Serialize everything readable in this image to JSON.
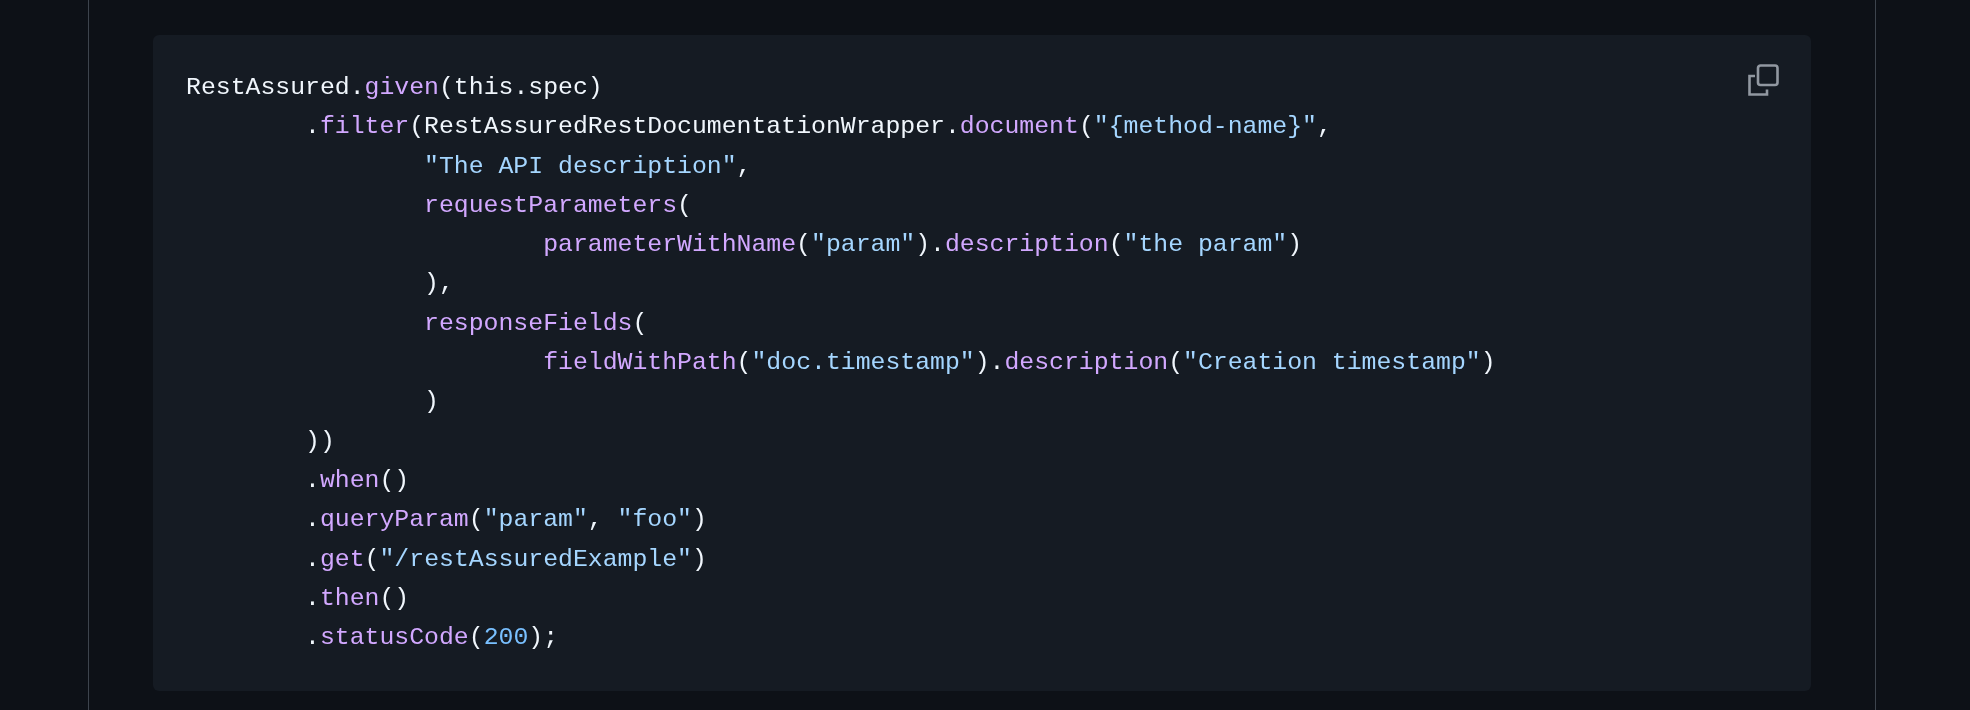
{
  "code_block": {
    "lines": [
      [
        {
          "kind": "plain",
          "text": "RestAssured."
        },
        {
          "kind": "function",
          "text": "given"
        },
        {
          "kind": "plain",
          "text": "(this.spec)"
        }
      ],
      [
        {
          "kind": "plain",
          "text": "        ."
        },
        {
          "kind": "function",
          "text": "filter"
        },
        {
          "kind": "plain",
          "text": "(RestAssuredRestDocumentationWrapper."
        },
        {
          "kind": "function",
          "text": "document"
        },
        {
          "kind": "plain",
          "text": "("
        },
        {
          "kind": "string",
          "text": "\"{method-name}\""
        },
        {
          "kind": "plain",
          "text": ","
        }
      ],
      [
        {
          "kind": "string",
          "text": "                \"The API description\""
        },
        {
          "kind": "plain",
          "text": ","
        }
      ],
      [
        {
          "kind": "function",
          "text": "                requestParameters"
        },
        {
          "kind": "plain",
          "text": "("
        }
      ],
      [
        {
          "kind": "function",
          "text": "                        parameterWithName"
        },
        {
          "kind": "plain",
          "text": "("
        },
        {
          "kind": "string",
          "text": "\"param\""
        },
        {
          "kind": "plain",
          "text": ")."
        },
        {
          "kind": "function",
          "text": "description"
        },
        {
          "kind": "plain",
          "text": "("
        },
        {
          "kind": "string",
          "text": "\"the param\""
        },
        {
          "kind": "plain",
          "text": ")"
        }
      ],
      [
        {
          "kind": "plain",
          "text": "                ),"
        }
      ],
      [
        {
          "kind": "function",
          "text": "                responseFields"
        },
        {
          "kind": "plain",
          "text": "("
        }
      ],
      [
        {
          "kind": "function",
          "text": "                        fieldWithPath"
        },
        {
          "kind": "plain",
          "text": "("
        },
        {
          "kind": "string",
          "text": "\"doc.timestamp\""
        },
        {
          "kind": "plain",
          "text": ")."
        },
        {
          "kind": "function",
          "text": "description"
        },
        {
          "kind": "plain",
          "text": "("
        },
        {
          "kind": "string",
          "text": "\"Creation timestamp\""
        },
        {
          "kind": "plain",
          "text": ")"
        }
      ],
      [
        {
          "kind": "plain",
          "text": "                )"
        }
      ],
      [
        {
          "kind": "plain",
          "text": "        ))"
        }
      ],
      [
        {
          "kind": "plain",
          "text": "        ."
        },
        {
          "kind": "function",
          "text": "when"
        },
        {
          "kind": "plain",
          "text": "()"
        }
      ],
      [
        {
          "kind": "plain",
          "text": "        ."
        },
        {
          "kind": "function",
          "text": "queryParam"
        },
        {
          "kind": "plain",
          "text": "("
        },
        {
          "kind": "string",
          "text": "\"param\""
        },
        {
          "kind": "plain",
          "text": ", "
        },
        {
          "kind": "string",
          "text": "\"foo\""
        },
        {
          "kind": "plain",
          "text": ")"
        }
      ],
      [
        {
          "kind": "plain",
          "text": "        ."
        },
        {
          "kind": "function",
          "text": "get"
        },
        {
          "kind": "plain",
          "text": "("
        },
        {
          "kind": "string",
          "text": "\"/restAssuredExample\""
        },
        {
          "kind": "plain",
          "text": ")"
        }
      ],
      [
        {
          "kind": "plain",
          "text": "        ."
        },
        {
          "kind": "function",
          "text": "then"
        },
        {
          "kind": "plain",
          "text": "()"
        }
      ],
      [
        {
          "kind": "plain",
          "text": "        ."
        },
        {
          "kind": "function",
          "text": "statusCode"
        },
        {
          "kind": "plain",
          "text": "("
        },
        {
          "kind": "number",
          "text": "200"
        },
        {
          "kind": "plain",
          "text": ");"
        }
      ]
    ]
  }
}
